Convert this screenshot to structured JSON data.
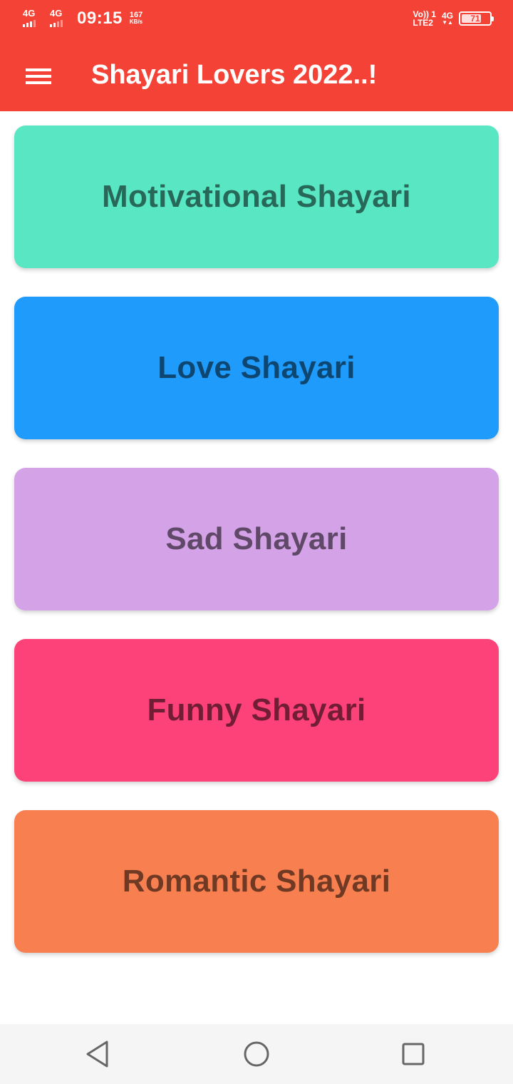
{
  "status_bar": {
    "sim1_label": "4G",
    "sim2_label": "4G",
    "time": "09:15",
    "speed_value": "167",
    "speed_unit": "KB/s",
    "volte_top": "Vo)) 1",
    "volte_bottom": "LTE2",
    "network_label": "4G",
    "network_arrows": "▼▲",
    "battery_level": "71",
    "battery_fraction": 0.71
  },
  "app_bar": {
    "title": "Shayari Lovers 2022..!",
    "menu_icon": "hamburger-menu-icon",
    "color": "#f44336"
  },
  "categories": [
    {
      "label": "Motivational Shayari",
      "color": "#58e6c3"
    },
    {
      "label": "Love Shayari",
      "color": "#1e9bfb"
    },
    {
      "label": "Sad Shayari",
      "color": "#d4a2e6"
    },
    {
      "label": "Funny Shayari",
      "color": "#fd4279"
    },
    {
      "label": "Romantic Shayari",
      "color": "#f77f50"
    }
  ],
  "nav_bar": {
    "back_icon": "back-triangle-icon",
    "home_icon": "home-circle-icon",
    "recents_icon": "recents-square-icon"
  }
}
